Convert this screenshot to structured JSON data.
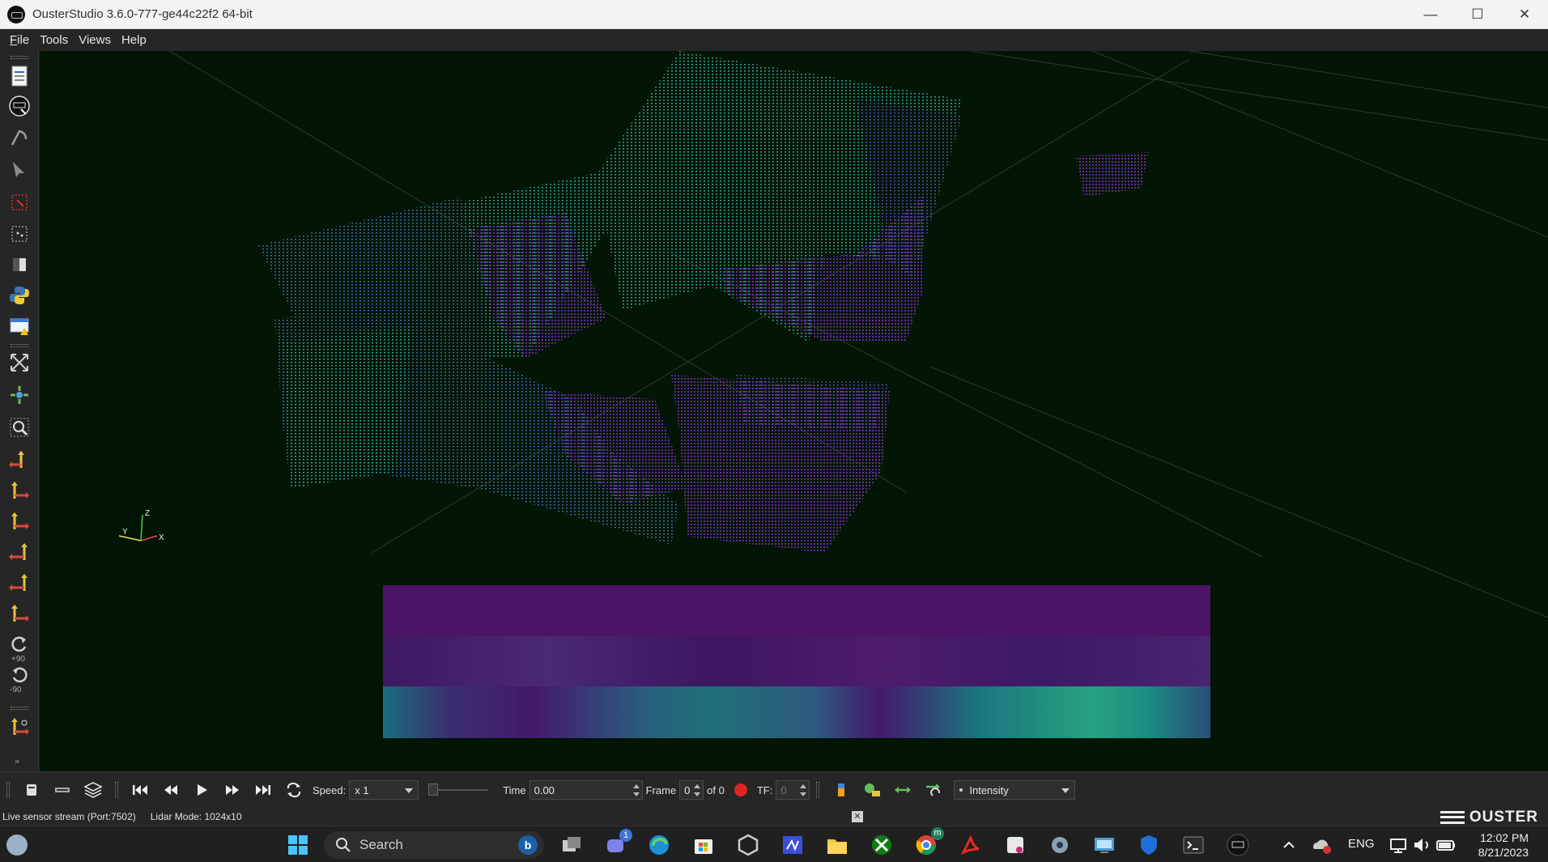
{
  "window": {
    "title": "OusterStudio 3.6.0-777-ge44c22f2 64-bit",
    "minimize_glyph": "—",
    "maximize_glyph": "☐",
    "close_glyph": "✕"
  },
  "menu": {
    "file_accel": "F",
    "file_rest": "ile",
    "tools": "Tools",
    "views": "Views",
    "help": "Help"
  },
  "left_toolbar": {
    "icons": [
      "open-file-icon",
      "sensor-stream-icon",
      "measure-icon",
      "pointer-icon",
      "select-cells-icon",
      "select-points-icon",
      "split-view-icon",
      "python-shell-icon",
      "warning-log-icon",
      "reset-camera-icon",
      "zoom-to-data-icon",
      "zoom-to-box-icon",
      "view-plus-x-icon",
      "view-minus-x-icon",
      "view-plus-y-icon",
      "view-minus-y-icon",
      "view-plus-z-icon",
      "view-minus-z-icon",
      "rotate-plus-90-icon",
      "rotate-minus-90-icon",
      "camera-orientation-icon"
    ],
    "rotate_plus_label": "+90",
    "rotate_minus_label": "-90"
  },
  "viewport": {
    "axes": {
      "x": "X",
      "y": "Y",
      "z": "Z"
    },
    "background_color": "#031505"
  },
  "playback": {
    "speed_label": "Speed:",
    "speed_value": "x 1",
    "time_label": "Time",
    "time_value": "0.00",
    "frame_label": "Frame",
    "frame_value": "0",
    "frame_total": "of 0",
    "tf_label": "TF:",
    "tf_value": "0",
    "color_by": "Intensity"
  },
  "status": {
    "stream": "Live sensor stream (Port:7502)",
    "lidar_mode": "Lidar Mode: 1024x10",
    "close_glyph": "✕",
    "brand": "OUSTER"
  },
  "taskbar": {
    "search_placeholder": "Search",
    "teams_badge": "1",
    "chrome_badge": "m",
    "language": "ENG",
    "time": "12:02 PM",
    "date": "8/21/2023"
  },
  "colors": {
    "accent_purple": "#4b1466",
    "accent_teal": "#27a27e",
    "record_red": "#e02424"
  }
}
